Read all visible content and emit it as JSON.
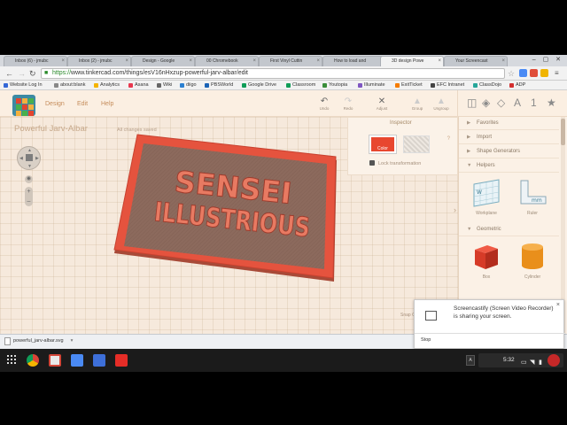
{
  "tabs": [
    {
      "label": "Inbox (6) - jmubc",
      "color": "#d44638"
    },
    {
      "label": "Inbox (2) - jmubc",
      "color": "#d44638"
    },
    {
      "label": "Design - Google",
      "color": "#4a8af4"
    },
    {
      "label": "00 Chromebook",
      "color": "#4a8af4"
    },
    {
      "label": "First Vinyl Cuttin",
      "color": "#e52d27"
    },
    {
      "label": "How to load and",
      "color": "#e52d27"
    },
    {
      "label": "3D design Powe",
      "color": "#2aa598"
    },
    {
      "label": "Your Screencast",
      "color": "#888888"
    }
  ],
  "address": {
    "scheme": "https://",
    "rest": "www.tinkercad.com/things/esV16nHxzup-powerful-jarv-albar/edit"
  },
  "bookmarks": [
    {
      "label": "Website Log In",
      "color": "#3367d6"
    },
    {
      "label": "about:blank",
      "color": "#888888"
    },
    {
      "label": "Analytics",
      "color": "#f4b400"
    },
    {
      "label": "Asana",
      "color": "#e8384f"
    },
    {
      "label": "Wiki",
      "color": "#666666"
    },
    {
      "label": "diigo",
      "color": "#2b80d1"
    },
    {
      "label": "PBSWorld",
      "color": "#1a63b6"
    },
    {
      "label": "Google Drive",
      "color": "#0f9d58"
    },
    {
      "label": "Classroom",
      "color": "#0f9d58"
    },
    {
      "label": "Youtopia",
      "color": "#3a8e3a"
    },
    {
      "label": "Illuminate",
      "color": "#7e57c2"
    },
    {
      "label": "ExitTicket",
      "color": "#f57c00"
    },
    {
      "label": "EFC Intranet",
      "color": "#444444"
    },
    {
      "label": "ClassDojo",
      "color": "#26a69a"
    },
    {
      "label": "ADP",
      "color": "#d32f2f"
    }
  ],
  "appbar": {
    "menu": [
      "Design",
      "Edit",
      "Help"
    ],
    "tools": [
      {
        "icon": "undo-icon",
        "glyph": "↶",
        "label": "Undo",
        "enabled": true
      },
      {
        "icon": "redo-icon",
        "glyph": "↷",
        "label": "Redo",
        "enabled": false
      },
      {
        "icon": "adjust-icon",
        "glyph": "✕",
        "label": "Adjust",
        "enabled": true
      },
      {
        "icon": "group-icon",
        "glyph": "▲",
        "label": "Group",
        "enabled": false
      },
      {
        "icon": "ungroup-icon",
        "glyph": "▲",
        "label": "Ungroup",
        "enabled": false
      }
    ],
    "view_letters": [
      "A",
      "1"
    ]
  },
  "design": {
    "title": "Powerful Jarv-Albar",
    "save_status": "All changes saved"
  },
  "object": {
    "line1": "SENSEI",
    "line2": "ILLUSTRIOUS",
    "color": "#e8472f"
  },
  "inspector": {
    "title": "Inspector",
    "color_label": "Color",
    "lock_label": "Lock transformation",
    "help": "?"
  },
  "zoom": {
    "plus": "+",
    "minus": "–"
  },
  "snap_grid": "Snap Grid",
  "panel": {
    "sections": [
      {
        "label": "Favorites",
        "expanded": false
      },
      {
        "label": "Import",
        "expanded": false
      },
      {
        "label": "Shape Generators",
        "expanded": false
      },
      {
        "label": "Helpers",
        "expanded": true
      },
      {
        "label": "Geometric",
        "expanded": true
      }
    ],
    "helpers": [
      "Workplane",
      "Ruler"
    ],
    "geometric": [
      "Box",
      "Cylinder"
    ],
    "ruler_unit": "mm"
  },
  "download": {
    "file": "powerful_jarv-albar.svg"
  },
  "notification": {
    "text": "Screencastify (Screen Video Recorder) is sharing your screen.",
    "action": "Stop"
  },
  "shelf": {
    "time": "5:32",
    "badge": "A"
  }
}
